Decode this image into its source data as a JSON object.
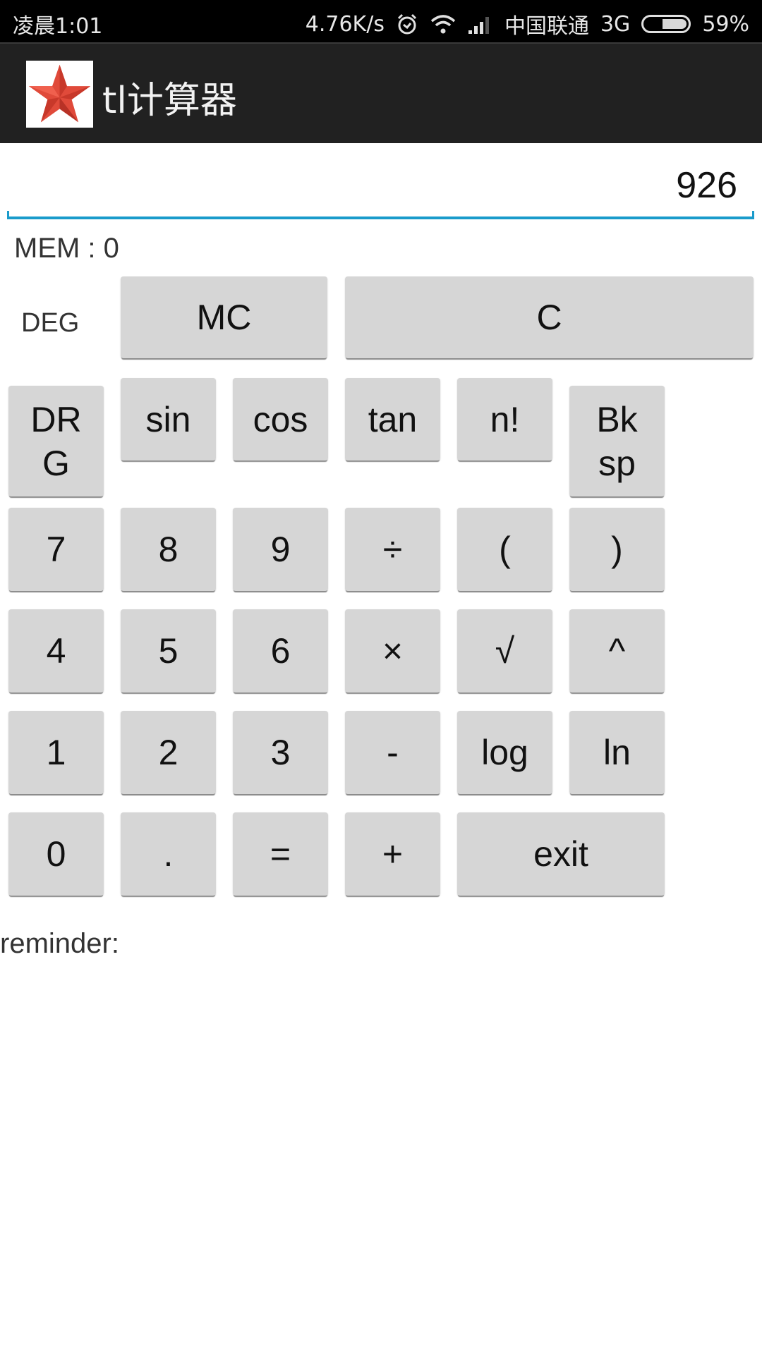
{
  "status_bar": {
    "time": "凌晨1:01",
    "net_speed": "4.76K/s",
    "carrier": "中国联通",
    "network_type": "3G",
    "battery_percent": "59%",
    "battery_level": 0.59,
    "icons": [
      "alarm-icon",
      "wifi-icon",
      "signal-icon",
      "battery-icon"
    ]
  },
  "action_bar": {
    "title": "tl计算器",
    "icon": "red-star-icon"
  },
  "display": {
    "value": "926"
  },
  "memory": {
    "label": "MEM :  0"
  },
  "angle_mode": "DEG",
  "buttons": {
    "mc": "MC",
    "c": "C",
    "drg": "DR\nG",
    "sin": "sin",
    "cos": "cos",
    "tan": "tan",
    "fact": "n!",
    "bksp": "Bk\nsp",
    "n7": "7",
    "n8": "8",
    "n9": "9",
    "div": "÷",
    "lparen": "(",
    "rparen": ")",
    "n4": "4",
    "n5": "5",
    "n6": "6",
    "mul": "×",
    "sqrt": "√",
    "pow": "^",
    "n1": "1",
    "n2": "2",
    "n3": "3",
    "sub": "-",
    "log": "log",
    "ln": "ln",
    "n0": "0",
    "dot": ".",
    "eq": "=",
    "add": "+",
    "exit": "exit"
  },
  "reminder": {
    "label": "reminder:"
  }
}
